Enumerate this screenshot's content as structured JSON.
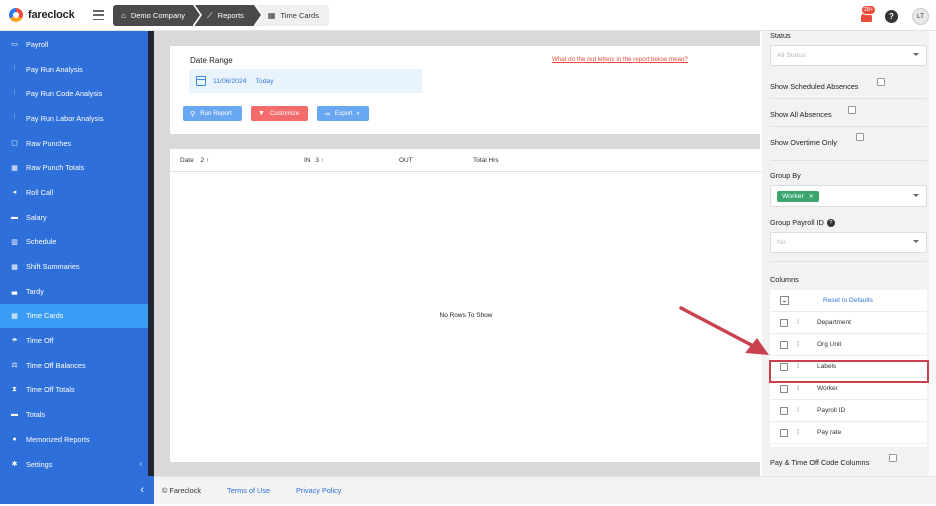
{
  "app": {
    "name": "fareclock"
  },
  "breadcrumbs": [
    "Demo Company",
    "Reports",
    "Time Cards"
  ],
  "header": {
    "notification_count": "28+",
    "help": "?",
    "avatar_initials": "LT"
  },
  "sidebar": {
    "items": [
      {
        "label": "Payroll",
        "icon": "payroll-icon"
      },
      {
        "label": "Pay Run Analysis",
        "icon": "analysis-icon"
      },
      {
        "label": "Pay Run Code Analysis",
        "icon": "analysis-icon"
      },
      {
        "label": "Pay Run Labor Analysis",
        "icon": "analysis-icon"
      },
      {
        "label": "Raw Punches",
        "icon": "punch-icon"
      },
      {
        "label": "Raw Punch Totals",
        "icon": "table-icon"
      },
      {
        "label": "Roll Call",
        "icon": "megaphone-icon"
      },
      {
        "label": "Salary",
        "icon": "salary-icon"
      },
      {
        "label": "Schedule",
        "icon": "calendar-icon"
      },
      {
        "label": "Shift Summaries",
        "icon": "table-icon"
      },
      {
        "label": "Tardy",
        "icon": "bed-icon"
      },
      {
        "label": "Time Cards",
        "icon": "table-icon",
        "active": true
      },
      {
        "label": "Time Off",
        "icon": "umbrella-icon"
      },
      {
        "label": "Time Off Balances",
        "icon": "balance-icon"
      },
      {
        "label": "Time Off Totals",
        "icon": "hourglass-icon"
      },
      {
        "label": "Totals",
        "icon": "totals-icon"
      },
      {
        "label": "Memorized Reports",
        "icon": "bulb-icon"
      },
      {
        "label": "Settings",
        "icon": "gear-icon"
      }
    ],
    "collapse_glyph": "‹"
  },
  "report": {
    "date_range_label": "Date Range",
    "red_letters_link": "What do the red letters in the report below mean?",
    "date_value": "11/06/2024",
    "today_label": "Today",
    "buttons": {
      "run": "Run Report",
      "customize": "Customize",
      "export": "Export"
    },
    "grid": {
      "columns": [
        "Date",
        "IN",
        "OUT",
        "Total Hrs"
      ],
      "sort": {
        "date": "2 ↑",
        "in": "3 ↑"
      },
      "empty_text": "No Rows To Show"
    }
  },
  "footer": {
    "copyright": "© Fareclock",
    "terms": "Terms of Use",
    "privacy": "Privacy Policy"
  },
  "panel": {
    "status_label": "Status",
    "status_placeholder": "All Status",
    "show_scheduled_absences": "Show Scheduled Absences",
    "show_all_absences": "Show All Absences",
    "show_overtime_only": "Show Overtime Only",
    "group_by_label": "Group By",
    "group_by_value": "Worker",
    "group_payroll_id_label": "Group Payroll ID",
    "group_payroll_id_value": "No",
    "columns_label": "Columns",
    "reset_defaults": "Reset to Defaults",
    "columns": [
      "Department",
      "Org Unit",
      "Labels",
      "Worker",
      "Payroll ID",
      "Pay rate"
    ],
    "pay_time_off_code_columns": "Pay & Time Off Code Columns"
  },
  "colors": {
    "sidebar_blue": "#2e6fd9",
    "active_item": "#3a9cf5",
    "customize_red": "#f36b6b",
    "highlight_red": "#c9404e",
    "tag_green": "#3aa66e"
  }
}
